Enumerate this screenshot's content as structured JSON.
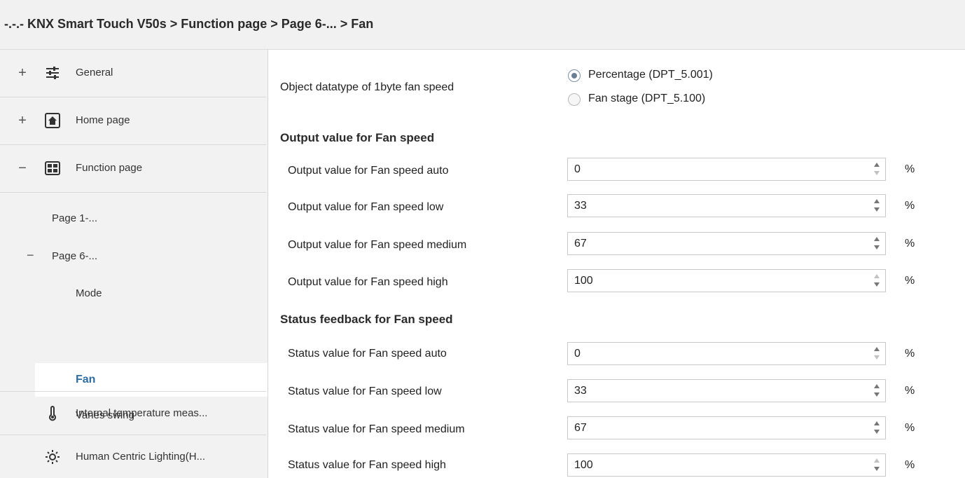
{
  "breadcrumb": "-.-.- KNX Smart Touch V50s > Function page > Page 6-... > Fan",
  "sidebar": {
    "general": {
      "sign": "+",
      "label": "General"
    },
    "home": {
      "sign": "+",
      "label": "Home page"
    },
    "function": {
      "sign": "−",
      "label": "Function page"
    },
    "page1": "Page 1-...",
    "page6": {
      "sign": "−",
      "label": "Page 6-..."
    },
    "mode": "Mode",
    "fan": "Fan",
    "vanes": "Vanes swing",
    "internal_temp": "Internal temperature meas...",
    "hcl": "Human Centric Lighting(H..."
  },
  "main": {
    "datatype_label": "Object datatype of 1byte fan speed",
    "datatype_options": [
      "Percentage (DPT_5.001)",
      "Fan stage (DPT_5.100)"
    ],
    "datatype_selected": "Percentage (DPT_5.001)",
    "output_section": "Output value for Fan speed",
    "output_rows": [
      {
        "label": "Output value for Fan speed auto",
        "value": "0",
        "unit": "%"
      },
      {
        "label": "Output value for Fan speed low",
        "value": "33",
        "unit": "%"
      },
      {
        "label": "Output value for Fan speed medium",
        "value": "67",
        "unit": "%"
      },
      {
        "label": "Output value for Fan speed high",
        "value": "100",
        "unit": "%"
      }
    ],
    "status_section": "Status feedback for Fan speed",
    "status_rows": [
      {
        "label": "Status value for Fan speed auto",
        "value": "0",
        "unit": "%"
      },
      {
        "label": "Status value for Fan speed low",
        "value": "33",
        "unit": "%"
      },
      {
        "label": "Status value for Fan speed medium",
        "value": "67",
        "unit": "%"
      },
      {
        "label": "Status value for Fan speed high",
        "value": "100",
        "unit": "%"
      }
    ]
  },
  "colors": {
    "selected_nav_text": "#2e6ca4",
    "sidebar_bg": "#f2f2f2",
    "titlebar_bg": "#f1f1f1"
  },
  "icons": [
    "sliders-icon",
    "home-icon",
    "grid-icon",
    "thermometer-icon",
    "sun-icon",
    "spinner-up-icon",
    "spinner-down-icon"
  ]
}
